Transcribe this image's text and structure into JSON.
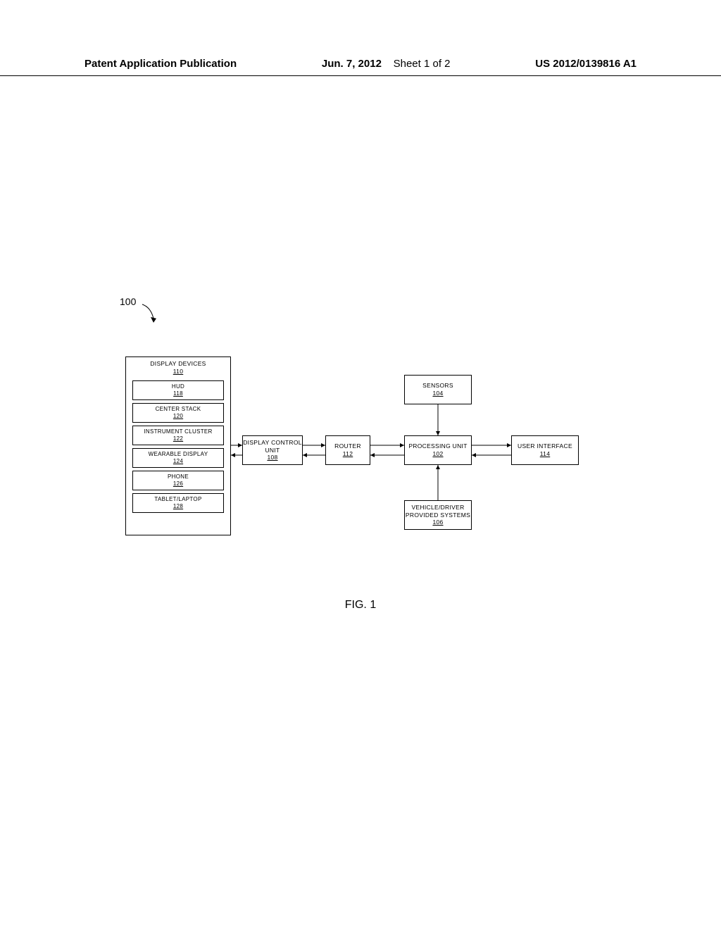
{
  "header": {
    "publication_label": "Patent Application Publication",
    "date": "Jun. 7, 2012",
    "sheet": "Sheet 1 of 2",
    "app_number": "US 2012/0139816 A1"
  },
  "figure": {
    "ref_label": "100",
    "caption": "FIG. 1"
  },
  "blocks": {
    "display_devices": {
      "label": "DISPLAY DEVICES",
      "ref": "110"
    },
    "hud": {
      "label": "HUD",
      "ref": "118"
    },
    "center_stack": {
      "label": "CENTER STACK",
      "ref": "120"
    },
    "instrument": {
      "label": "INSTRUMENT CLUSTER",
      "ref": "122"
    },
    "wearable": {
      "label": "WEARABLE DISPLAY",
      "ref": "124"
    },
    "phone": {
      "label": "PHONE",
      "ref": "126"
    },
    "tablet": {
      "label": "TABLET/LAPTOP",
      "ref": "128"
    },
    "dcu": {
      "label": "DISPLAY CONTROL UNIT",
      "ref": "108"
    },
    "router": {
      "label": "ROUTER",
      "ref": "112"
    },
    "processing": {
      "label": "PROCESSING UNIT",
      "ref": "102"
    },
    "ui": {
      "label": "USER INTERFACE",
      "ref": "114"
    },
    "sensors": {
      "label": "SENSORS",
      "ref": "104"
    },
    "systems": {
      "label": "VEHICLE/DRIVER PROVIDED SYSTEMS",
      "ref": "106"
    }
  },
  "chart_data": {
    "type": "diagram",
    "title": "FIG. 1",
    "ref": "100",
    "nodes": [
      {
        "id": "display_devices",
        "label": "DISPLAY DEVICES",
        "ref": "110",
        "children": [
          "hud",
          "center_stack",
          "instrument",
          "wearable",
          "phone",
          "tablet"
        ]
      },
      {
        "id": "hud",
        "label": "HUD",
        "ref": "118"
      },
      {
        "id": "center_stack",
        "label": "CENTER STACK",
        "ref": "120"
      },
      {
        "id": "instrument",
        "label": "INSTRUMENT CLUSTER",
        "ref": "122"
      },
      {
        "id": "wearable",
        "label": "WEARABLE DISPLAY",
        "ref": "124"
      },
      {
        "id": "phone",
        "label": "PHONE",
        "ref": "126"
      },
      {
        "id": "tablet",
        "label": "TABLET/LAPTOP",
        "ref": "128"
      },
      {
        "id": "dcu",
        "label": "DISPLAY CONTROL UNIT",
        "ref": "108"
      },
      {
        "id": "router",
        "label": "ROUTER",
        "ref": "112"
      },
      {
        "id": "processing",
        "label": "PROCESSING UNIT",
        "ref": "102"
      },
      {
        "id": "ui",
        "label": "USER INTERFACE",
        "ref": "114"
      },
      {
        "id": "sensors",
        "label": "SENSORS",
        "ref": "104"
      },
      {
        "id": "systems",
        "label": "VEHICLE/DRIVER PROVIDED SYSTEMS",
        "ref": "106"
      }
    ],
    "edges": [
      {
        "from": "display_devices",
        "to": "dcu",
        "bidirectional": true
      },
      {
        "from": "dcu",
        "to": "router",
        "bidirectional": true
      },
      {
        "from": "router",
        "to": "processing",
        "bidirectional": true
      },
      {
        "from": "processing",
        "to": "ui",
        "bidirectional": true
      },
      {
        "from": "sensors",
        "to": "processing",
        "bidirectional": false
      },
      {
        "from": "systems",
        "to": "processing",
        "bidirectional": false
      }
    ]
  }
}
